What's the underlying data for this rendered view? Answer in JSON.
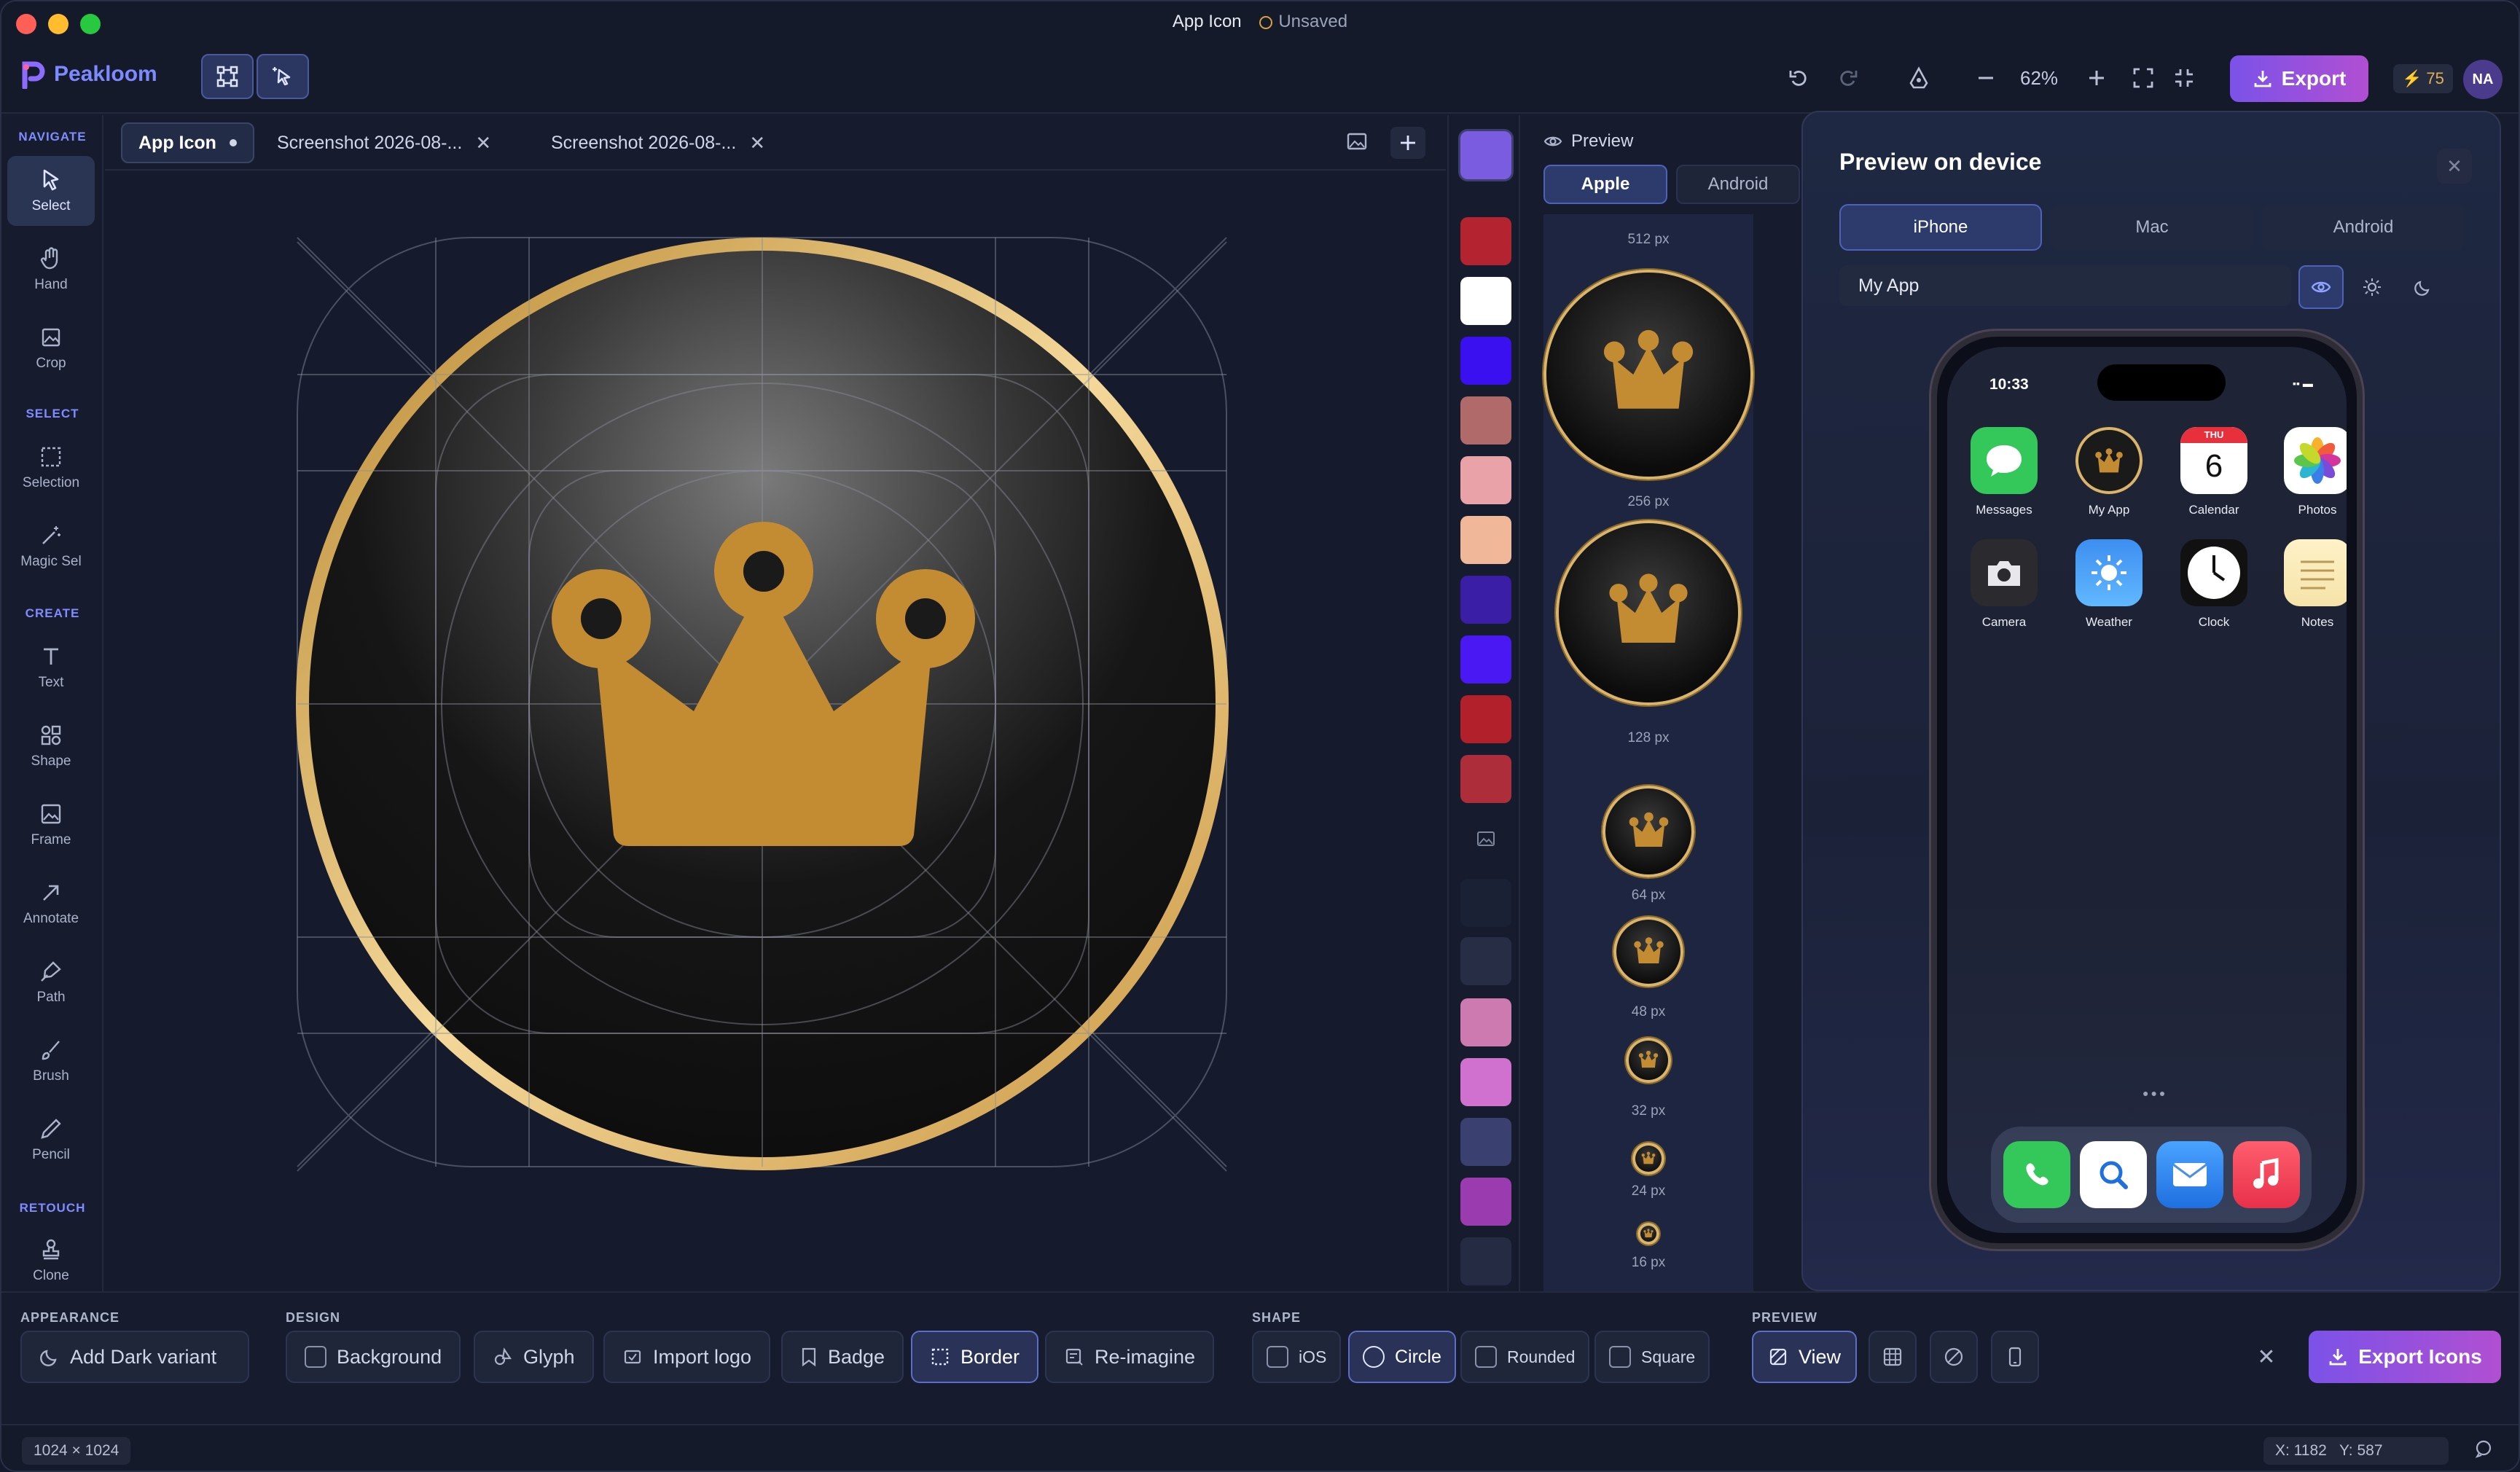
{
  "window": {
    "title": "App Icon",
    "status": "Unsaved"
  },
  "brand": {
    "name": "Peakloom",
    "accent": "#7c89ff"
  },
  "toolbar": {
    "zoom": "62%",
    "export_label": "Export",
    "credits": "75",
    "avatar_initials": "NA"
  },
  "leftbar": {
    "sections": [
      "NAVIGATE",
      "SELECT",
      "CREATE",
      "RETOUCH"
    ],
    "tools": [
      "Select",
      "Hand",
      "Crop",
      "Selection",
      "Magic Sel",
      "Text",
      "Shape",
      "Frame",
      "Annotate",
      "Path",
      "Brush",
      "Pencil",
      "Clone"
    ]
  },
  "tabs": [
    "App Icon",
    "Screenshot 2026-08-...",
    "Screenshot 2026-08-..."
  ],
  "palette": [
    "#7a5ce0",
    "#b32430",
    "#ffffff",
    "#3a10f0",
    "#b06a6a",
    "#e8a2a8",
    "#f0b898",
    "#3a1ea6",
    "#4a18f2",
    "#b2202c",
    "#ad2e3a",
    "",
    "#1b2134",
    "#262d45",
    "#cc7ab0",
    "#d070cf",
    "#3a4170",
    "#9a3cb0",
    "#242b43"
  ],
  "preview": {
    "title": "Preview",
    "platforms": [
      "Apple",
      "Android"
    ],
    "sizes": [
      "512 px",
      "256 px",
      "128 px",
      "64 px",
      "48 px",
      "32 px",
      "24 px",
      "16 px"
    ]
  },
  "device": {
    "title": "Preview on device",
    "devices": [
      "iPhone",
      "Mac",
      "Android"
    ],
    "app_name": "My App",
    "time": "10:33",
    "calendar": {
      "day": "THU",
      "date": "6"
    },
    "apps": [
      "Messages",
      "My App",
      "Calendar",
      "Photos",
      "Camera",
      "Weather",
      "Clock",
      "Notes"
    ]
  },
  "bottom": {
    "appearance": {
      "label": "APPEARANCE",
      "add_dark": "Add Dark variant"
    },
    "design": {
      "label": "DESIGN",
      "items": [
        "Background",
        "Glyph",
        "Import logo",
        "Badge",
        "Border",
        "Re-imagine"
      ]
    },
    "shape": {
      "label": "SHAPE",
      "items": [
        "iOS",
        "Circle",
        "Rounded",
        "Square"
      ]
    },
    "preview": {
      "label": "PREVIEW",
      "view": "View"
    },
    "export_icons": "Export Icons"
  },
  "status": {
    "dimensions": "1024 × 1024",
    "coords": "X: 1182   Y: 587"
  },
  "colors": {
    "gold": "#c8922f",
    "export_gradient_start": "#7b52e8",
    "export_gradient_end": "#b14fd2"
  }
}
